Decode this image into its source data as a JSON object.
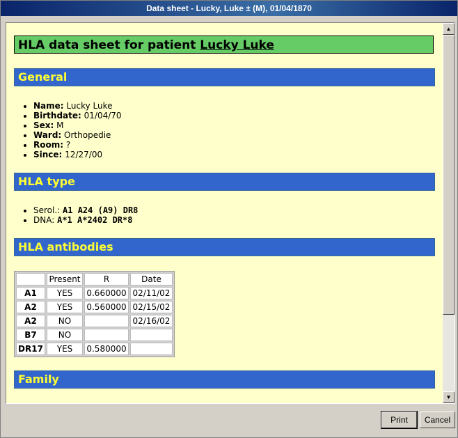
{
  "window": {
    "title": "Data sheet - Lucky, Luke ± (M), 01/04/1870"
  },
  "sheet": {
    "title_prefix": "HLA data sheet for patient ",
    "patient_name": "Lucky Luke"
  },
  "general": {
    "heading": "General",
    "items": [
      {
        "label": "Name:",
        "value": "Lucky Luke"
      },
      {
        "label": "Birthdate:",
        "value": "01/04/70"
      },
      {
        "label": "Sex:",
        "value": "M"
      },
      {
        "label": "Ward:",
        "value": "Orthopedie"
      },
      {
        "label": "Room:",
        "value": "?"
      },
      {
        "label": "Since:",
        "value": "12/27/00"
      }
    ]
  },
  "hla_type": {
    "heading": "HLA type",
    "serol_label": "Serol.:",
    "serol_value": "A1 A24 (A9) DR8",
    "dna_label": "DNA:",
    "dna_value": "A*1 A*2402 DR*8"
  },
  "hla_antibodies": {
    "heading": "HLA antibodies",
    "columns": [
      "",
      "Present",
      "R",
      "Date"
    ],
    "rows": [
      {
        "name": "A1",
        "present": "YES",
        "r": "0.660000",
        "date": "02/11/02"
      },
      {
        "name": "A2",
        "present": "YES",
        "r": "0.560000",
        "date": "02/15/02"
      },
      {
        "name": "A2",
        "present": "NO",
        "r": "",
        "date": "02/16/02"
      },
      {
        "name": "B7",
        "present": "NO",
        "r": "",
        "date": ""
      },
      {
        "name": "DR17",
        "present": "YES",
        "r": "0.580000",
        "date": ""
      }
    ]
  },
  "family": {
    "heading": "Family"
  },
  "buttons": {
    "print": "Print",
    "cancel": "Cancel"
  }
}
